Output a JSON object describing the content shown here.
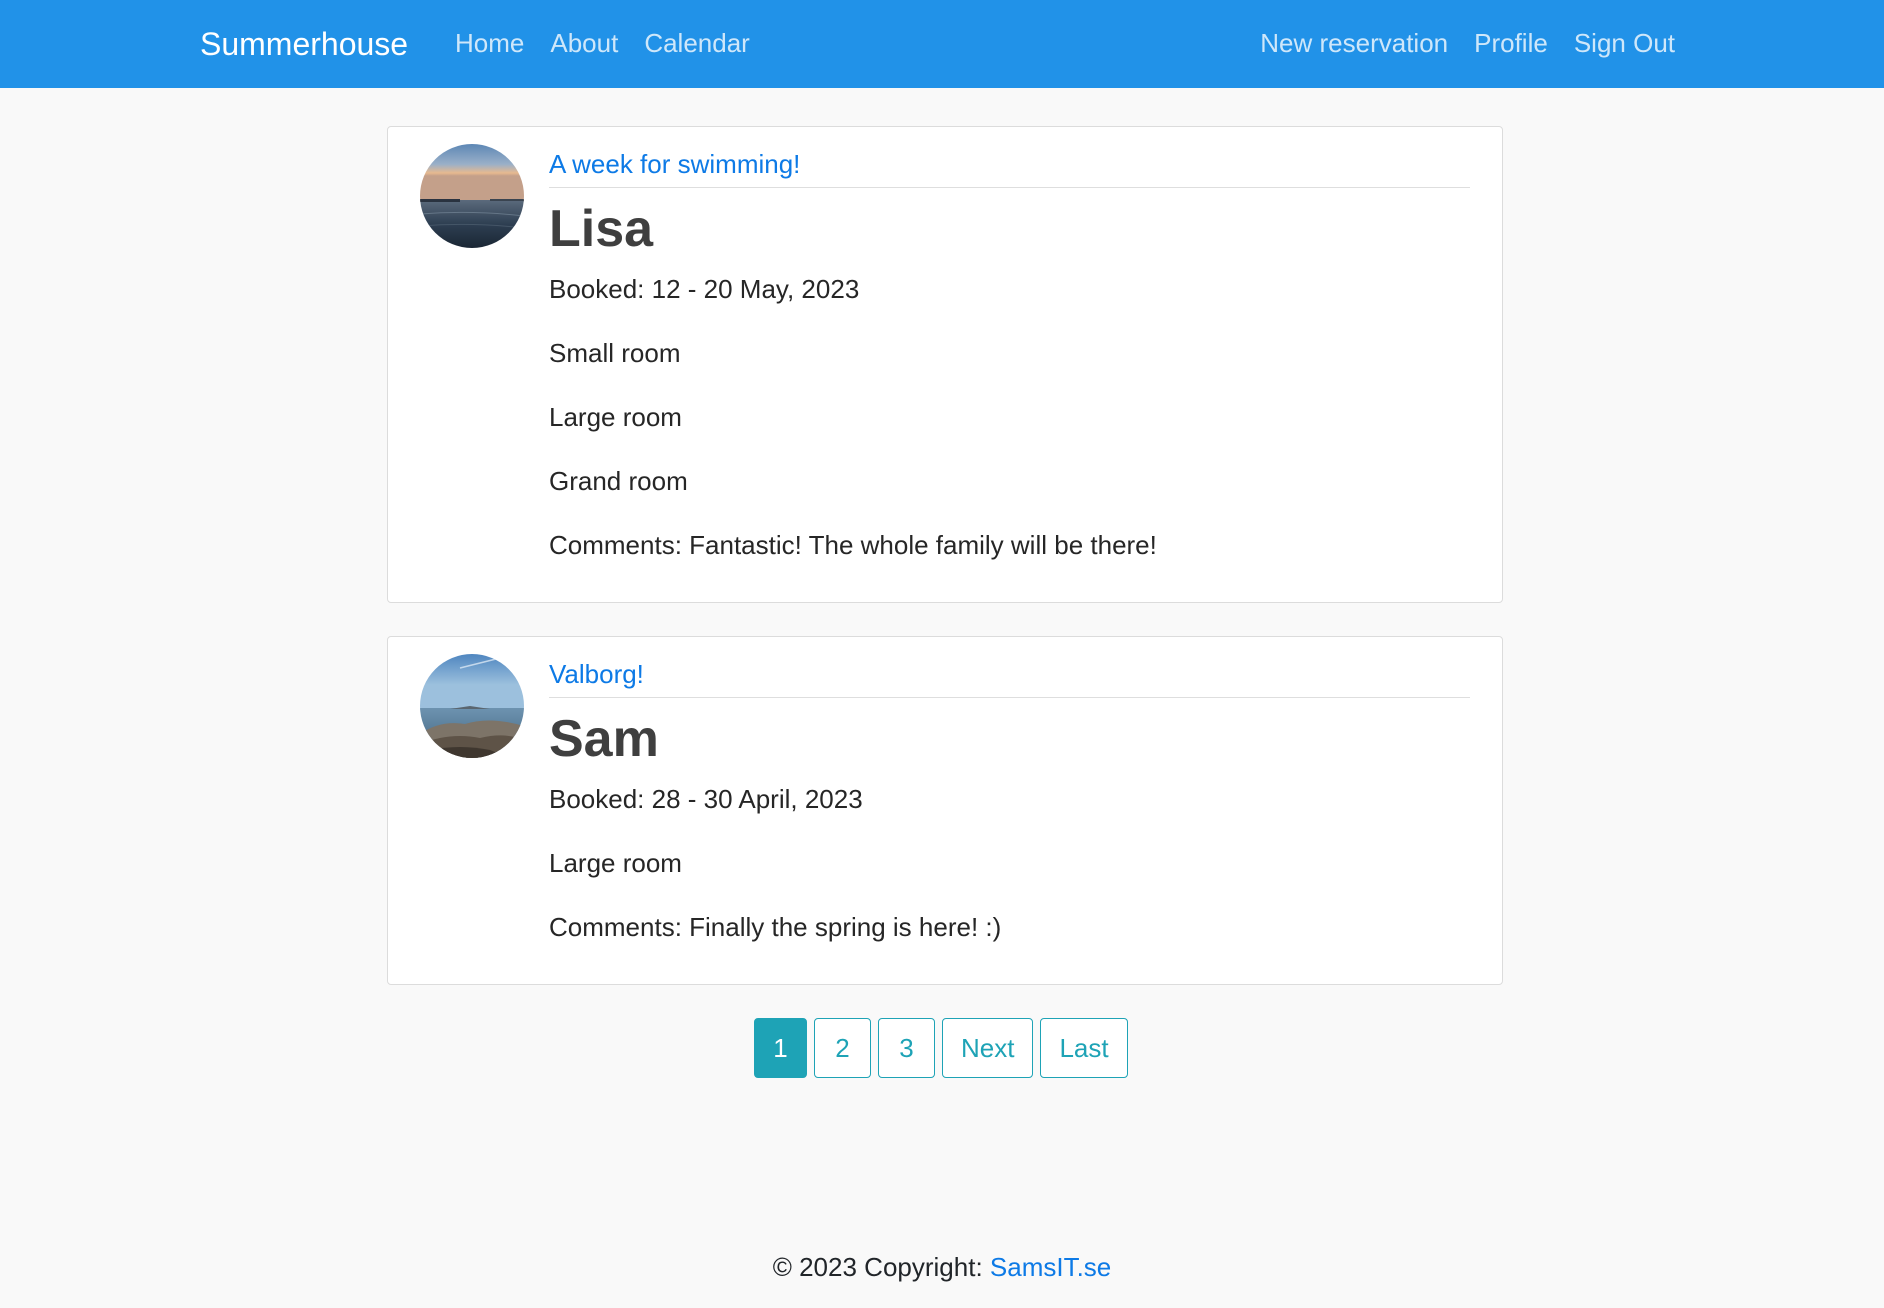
{
  "navbar": {
    "brand": "Summerhouse",
    "left_links": [
      "Home",
      "About",
      "Calendar"
    ],
    "right_links": [
      "New reservation",
      "Profile",
      "Sign Out"
    ],
    "background_color": "#2192e8"
  },
  "reservations": [
    {
      "title": "A week for swimming!",
      "name": "Lisa",
      "booked": "Booked: 12 - 20 May, 2023",
      "rooms": [
        "Small room",
        "Large room",
        "Grand room"
      ],
      "comments": "Comments: Fantastic! The whole family will be there!"
    },
    {
      "title": "Valborg!",
      "name": "Sam",
      "booked": "Booked: 28 - 30 April, 2023",
      "rooms": [
        "Large room"
      ],
      "comments": "Comments: Finally the spring is here! :)"
    }
  ],
  "pagination": {
    "pages": [
      "1",
      "2",
      "3"
    ],
    "active_page": "1",
    "next_label": "Next",
    "last_label": "Last",
    "accent_color": "#1ea3b6"
  },
  "footer": {
    "text": "© 2023 Copyright: ",
    "link": "SamsIT.se"
  }
}
